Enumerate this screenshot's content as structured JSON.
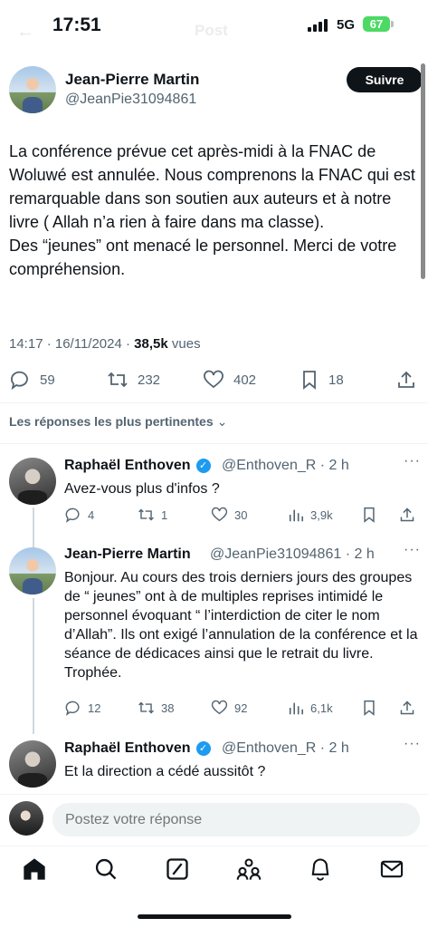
{
  "status_bar": {
    "time": "17:51",
    "network": "5G",
    "battery": "67",
    "header_title": "Post"
  },
  "main_tweet": {
    "author_name": "Jean-Pierre Martin",
    "author_handle": "@JeanPie31094861",
    "follow_label": "Suivre",
    "text": "La conférence prévue cet après-midi à la FNAC de Woluwé est annulée. Nous comprenons la FNAC qui est remarquable dans son soutien aux auteurs et à notre livre ( Allah n’a rien à faire dans ma classe).\nDes “jeunes” ont menacé le personnel. Merci de votre compréhension.",
    "timestamp": "14:17 · 16/11/2024 · ",
    "views_count": "38,5k",
    "views_label": " vues",
    "replies": "59",
    "reposts": "232",
    "likes": "402",
    "bookmarks": "18"
  },
  "replies_sort_label": "Les réponses les plus pertinentes",
  "replies": [
    {
      "name": "Raphaël Enthoven",
      "handle": "@Enthoven_R · 2 h",
      "text": "Avez-vous plus d'infos ?",
      "replies": "4",
      "reposts": "1",
      "likes": "30",
      "views": "3,9k"
    },
    {
      "name": "Jean-Pierre Martin",
      "handle": "@JeanPie31094861 · 2 h",
      "text": "Bonjour. Au cours des trois derniers jours des groupes de “ jeunes” ont à de multiples reprises intimidé le personnel évoquant “ l’interdiction de citer le nom d’Allah”. Ils ont exigé l’annulation de la conférence et la séance de dédicaces ainsi que le retrait du livre. Trophée.",
      "replies": "12",
      "reposts": "38",
      "likes": "92",
      "views": "6,1k"
    },
    {
      "name": "Raphaël Enthoven",
      "handle": "@Enthoven_R · 2 h",
      "text": "Et la direction a cédé aussitôt ?"
    }
  ],
  "compose": {
    "placeholder": "Postez votre réponse"
  },
  "icons": {
    "reply": "reply-icon",
    "repost": "repost-icon",
    "like": "heart-icon",
    "bookmark": "bookmark-icon",
    "share": "share-icon",
    "views": "views-icon",
    "nav": [
      "home-icon",
      "search-icon",
      "grok-icon",
      "communities-icon",
      "notifications-icon",
      "messages-icon"
    ]
  },
  "colors": {
    "accent": "#1d9bf0",
    "text": "#0f1419",
    "muted": "#536471",
    "battery": "#4cd964"
  }
}
